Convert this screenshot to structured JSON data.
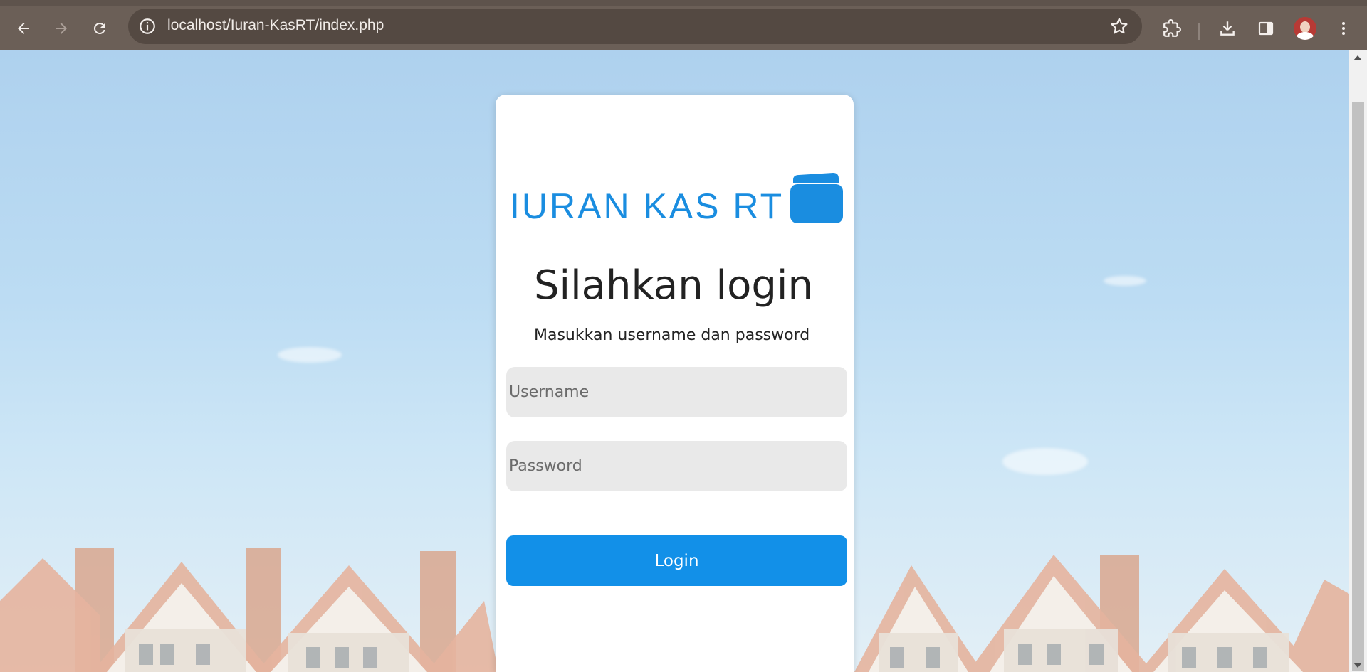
{
  "browser": {
    "url": "localhost/Iuran-KasRT/index.php",
    "icons": [
      "back-icon",
      "forward-icon",
      "reload-icon",
      "site-info-icon",
      "bookmark-star-icon",
      "extensions-icon",
      "download-icon",
      "side-panel-icon",
      "profile-avatar",
      "menu-icon"
    ]
  },
  "login": {
    "logo_text": "IURAN KAS RT",
    "heading": "Silahkan login",
    "subheading": "Masukkan username dan password",
    "username_placeholder": "Username",
    "password_placeholder": "Password",
    "button_label": "Login"
  },
  "colors": {
    "brand": "#1a8de0",
    "button": "#1290e8",
    "browser_bar": "#6b5f57"
  }
}
